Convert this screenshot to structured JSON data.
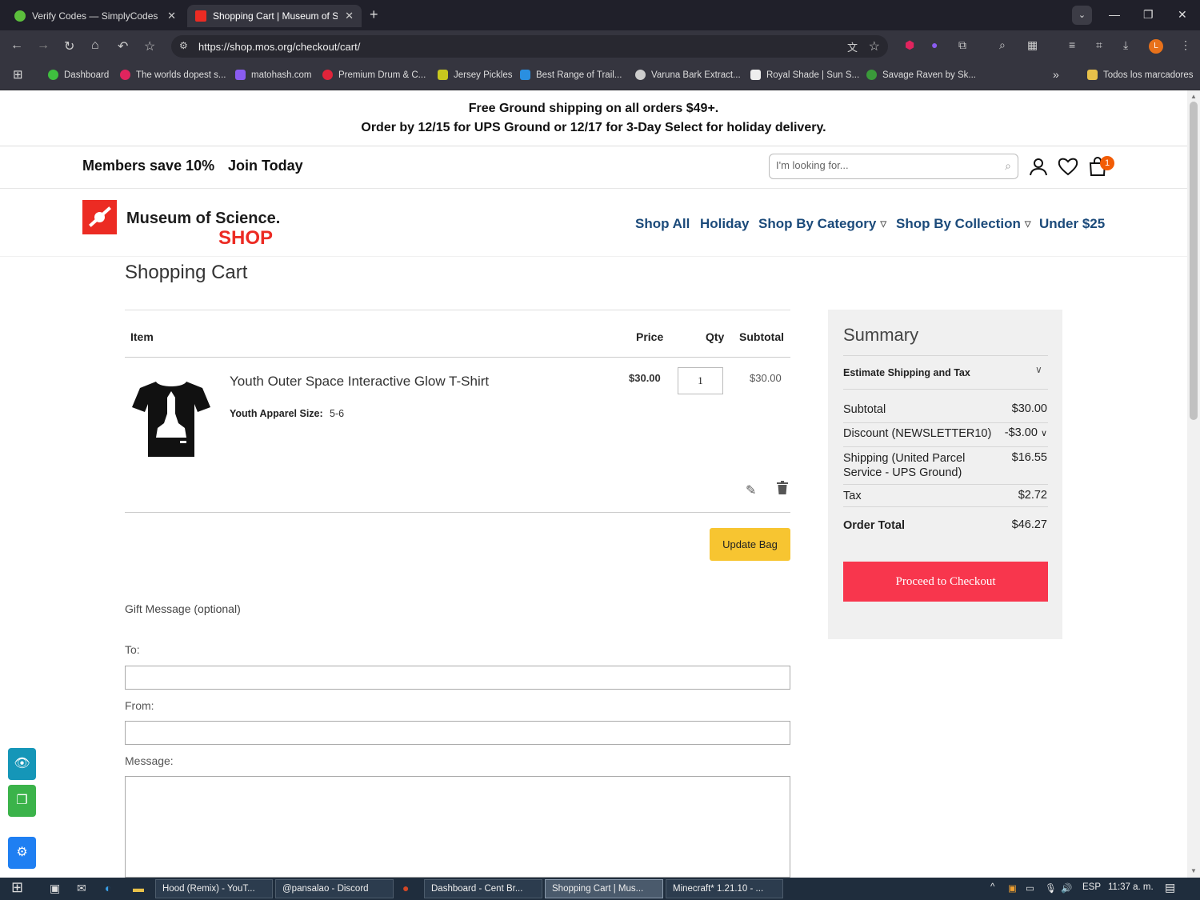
{
  "browser": {
    "tabs": [
      {
        "title": "Verify Codes — SimplyCodes",
        "active": false
      },
      {
        "title": "Shopping Cart | Museum of Sci",
        "active": true
      }
    ],
    "url": "https://shop.mos.org/checkout/cart/",
    "profile_initial": "L",
    "bookmarks": [
      {
        "label": "Dashboard",
        "color": "#3fbf3f"
      },
      {
        "label": "The worlds dopest s...",
        "color": "#e0245e"
      },
      {
        "label": "matohash.com",
        "color": "#8a5cf0"
      },
      {
        "label": "Premium Drum & C...",
        "color": "#e0243a"
      },
      {
        "label": "Jersey Pickles",
        "color": "#c8c81e"
      },
      {
        "label": "Best Range of Trail...",
        "color": "#2a8fe0"
      },
      {
        "label": "Varuna Bark Extract...",
        "color": "#cccccc"
      },
      {
        "label": "Royal Shade | Sun S...",
        "color": "#eeeeee"
      },
      {
        "label": "Savage Raven by Sk...",
        "color": "#3a9a3a"
      }
    ],
    "all_bookmarks": "Todos los marcadores"
  },
  "promo": {
    "line1": "Free Ground shipping on all orders $49+.",
    "line2": "Order by 12/15 for UPS Ground or 12/17 for 3-Day Select for holiday delivery."
  },
  "header": {
    "members": "Members save 10%",
    "join": "Join Today",
    "search_placeholder": "I'm looking for...",
    "cart_count": "1"
  },
  "logo": {
    "name": "Museum of Science.",
    "shop": "SHOP"
  },
  "nav": [
    {
      "label": "Shop All"
    },
    {
      "label": "Holiday"
    },
    {
      "label": "Shop By Category"
    },
    {
      "label": "Shop By Collection"
    },
    {
      "label": "Under $25"
    }
  ],
  "cart": {
    "title": "Shopping Cart",
    "columns": {
      "item": "Item",
      "price": "Price",
      "qty": "Qty",
      "subtotal": "Subtotal"
    },
    "item": {
      "name": "Youth Outer Space Interactive Glow T-Shirt",
      "option_label": "Youth Apparel Size:",
      "option_value": "5-6",
      "price": "$30.00",
      "qty": "1",
      "subtotal": "$30.00"
    },
    "update_label": "Update Bag"
  },
  "gift": {
    "title": "Gift Message (optional)",
    "to_label": "To:",
    "from_label": "From:",
    "message_label": "Message:"
  },
  "summary": {
    "title": "Summary",
    "estimate": "Estimate Shipping and Tax",
    "rows": {
      "subtotal_label": "Subtotal",
      "subtotal_value": "$30.00",
      "discount_label": "Discount (NEWSLETTER10)",
      "discount_value": "-$3.00",
      "shipping_label": "Shipping (United Parcel Service - UPS Ground)",
      "shipping_value": "$16.55",
      "tax_label": "Tax",
      "tax_value": "$2.72",
      "total_label": "Order Total",
      "total_value": "$46.27"
    },
    "checkout_label": "Proceed to Checkout"
  },
  "taskbar": {
    "items": [
      {
        "label": "Hood (Remix) - YouT..."
      },
      {
        "label": "@pansalao - Discord"
      },
      {
        "label": "Dashboard - Cent Br..."
      },
      {
        "label": "Shopping Cart | Mus..."
      },
      {
        "label": "Minecraft* 1.21.10 - ..."
      }
    ],
    "lang": "ESP",
    "time": "11:37 a. m."
  }
}
